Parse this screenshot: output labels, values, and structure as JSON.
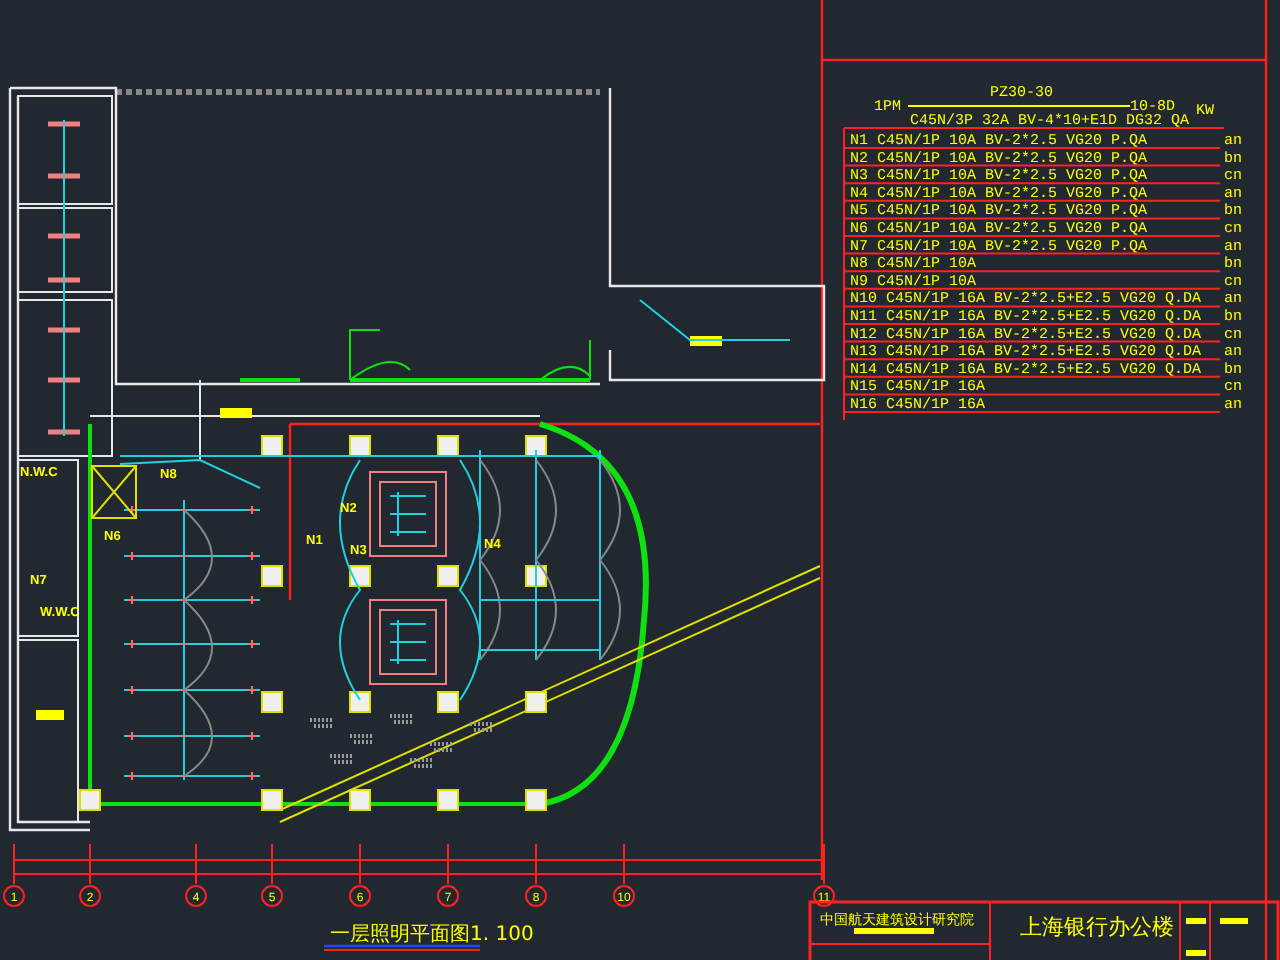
{
  "panel": {
    "name": "1PM",
    "model": "PZ30-30",
    "rating": "10-8D",
    "unit": "KW",
    "main_circuit": "C45N/3P 32A BV-4*10+E1D DG32 QA"
  },
  "circuits": [
    {
      "text": "N1 C45N/1P 10A BV-2*2.5 VG20 P.QA",
      "phase": "an"
    },
    {
      "text": "N2 C45N/1P 10A BV-2*2.5 VG20 P.QA",
      "phase": "bn"
    },
    {
      "text": "N3 C45N/1P 10A BV-2*2.5 VG20 P.QA",
      "phase": "cn"
    },
    {
      "text": "N4 C45N/1P 10A BV-2*2.5 VG20 P.QA",
      "phase": "an"
    },
    {
      "text": "N5 C45N/1P 10A BV-2*2.5 VG20 P.QA",
      "phase": "bn"
    },
    {
      "text": "N6 C45N/1P 10A BV-2*2.5 VG20 P.QA",
      "phase": "cn"
    },
    {
      "text": "N7 C45N/1P 10A BV-2*2.5 VG20 P.QA",
      "phase": "an"
    },
    {
      "text": "N8 C45N/1P 10A",
      "phase": "bn"
    },
    {
      "text": "N9 C45N/1P 10A",
      "phase": "cn"
    },
    {
      "text": "N10 C45N/1P 16A BV-2*2.5+E2.5 VG20 Q.DA",
      "phase": "an"
    },
    {
      "text": "N11 C45N/1P 16A BV-2*2.5+E2.5 VG20 Q.DA",
      "phase": "bn"
    },
    {
      "text": "N12 C45N/1P 16A BV-2*2.5+E2.5 VG20 Q.DA",
      "phase": "cn"
    },
    {
      "text": "N13 C45N/1P 16A BV-2*2.5+E2.5 VG20 Q.DA",
      "phase": "an"
    },
    {
      "text": "N14 C45N/1P 16A BV-2*2.5+E2.5 VG20 Q.DA",
      "phase": "bn"
    },
    {
      "text": "N15 C45N/1P 16A",
      "phase": "cn"
    },
    {
      "text": "N16 C45N/1P 16A",
      "phase": "an"
    }
  ],
  "plan_labels": [
    "N.W.C",
    "N7",
    "W.W.C",
    "N8",
    "N6",
    "N1",
    "N2",
    "N3",
    "N4"
  ],
  "axes": [
    "1",
    "2",
    "4",
    "5",
    "6",
    "7",
    "8",
    "10",
    "11"
  ],
  "drawing_title": "一层照明平面图1. 100",
  "title_block": {
    "institute": "中国航天建筑设计研究院",
    "project": "上海银行办公楼"
  }
}
